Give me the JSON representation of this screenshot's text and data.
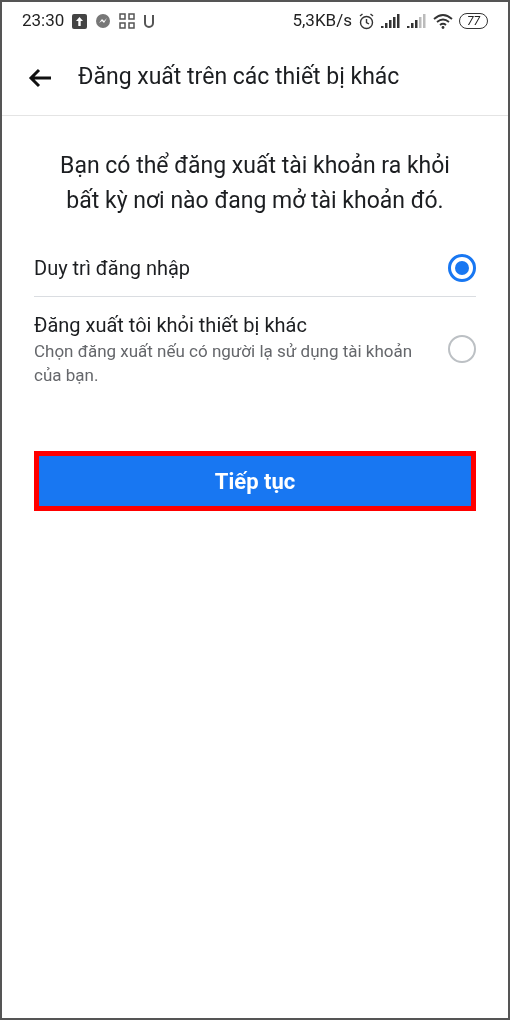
{
  "status_bar": {
    "time": "23:30",
    "speed": "5,3KB/s",
    "battery": "77"
  },
  "header": {
    "title": "Đăng xuất trên các thiết bị khác"
  },
  "intro": "Bạn có thể đăng xuất tài khoản ra khỏi bất kỳ nơi nào đang mở tài khoản đó.",
  "options": [
    {
      "label": "Duy trì đăng nhập",
      "selected": true
    },
    {
      "label": "Đăng xuất tôi khỏi thiết bị khác",
      "description": "Chọn đăng xuất nếu có người lạ sử dụng tài khoản của bạn.",
      "selected": false
    }
  ],
  "continue_button": {
    "label": "Tiếp tục",
    "highlighted": true
  }
}
